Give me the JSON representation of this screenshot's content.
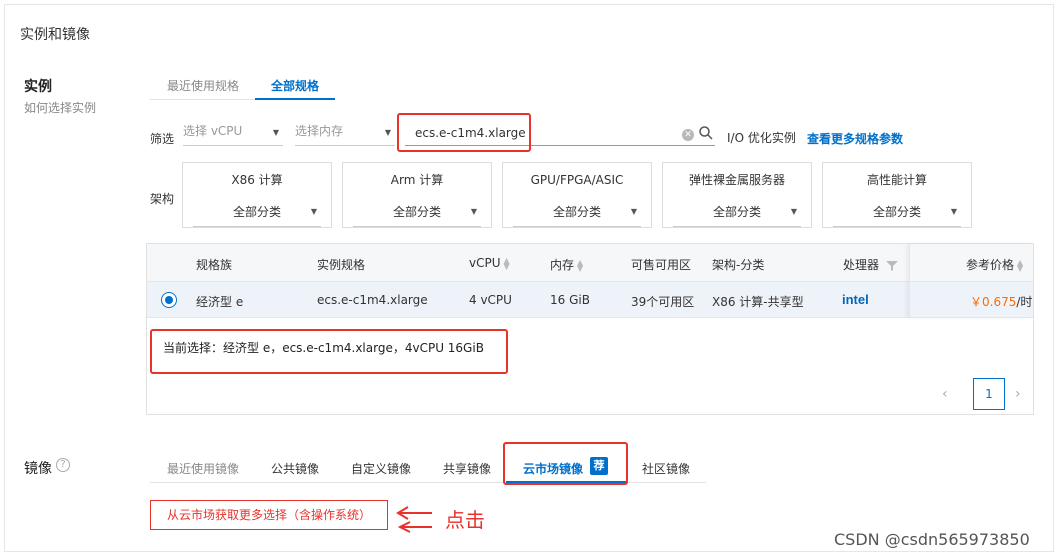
{
  "section_title": "实例和镜像",
  "instance": {
    "label": "实例",
    "help_text": "如何选择实例",
    "tabs": [
      {
        "label": "最近使用规格",
        "active": false
      },
      {
        "label": "全部规格",
        "active": true
      }
    ],
    "filter": {
      "label": "筛选",
      "vcpu_placeholder": "选择 vCPU",
      "memory_placeholder": "选择内存",
      "search_value": "ecs.e-c1m4.xlarge",
      "io_label": "I/O 优化实例",
      "more_link": "查看更多规格参数"
    },
    "arch": {
      "label": "架构",
      "cards": [
        {
          "title": "X86 计算",
          "select": "全部分类"
        },
        {
          "title": "Arm 计算",
          "select": "全部分类"
        },
        {
          "title": "GPU/FPGA/ASIC",
          "select": "全部分类"
        },
        {
          "title": "弹性裸金属服务器",
          "select": "全部分类"
        },
        {
          "title": "高性能计算",
          "select": "全部分类"
        }
      ]
    },
    "table": {
      "columns": [
        "规格族",
        "实例规格",
        "vCPU",
        "内存",
        "可售可用区",
        "架构-分类",
        "处理器",
        "参考价格"
      ],
      "row": {
        "family": "经济型 e",
        "spec": "ecs.e-c1m4.xlarge",
        "vcpu": "4 vCPU",
        "memory": "16 GiB",
        "zones": "39个可用区",
        "arch_class": "X86 计算-共享型",
        "processor": "intel",
        "price": "￥0.675",
        "price_unit": "/时"
      },
      "current_selection": "当前选择：经济型 e，ecs.e-c1m4.xlarge，4vCPU 16GiB",
      "page": "1"
    }
  },
  "image": {
    "label": "镜像",
    "tabs": [
      {
        "label": "最近使用镜像",
        "active": false
      },
      {
        "label": "公共镜像",
        "active": false
      },
      {
        "label": "自定义镜像",
        "active": false
      },
      {
        "label": "共享镜像",
        "active": false
      },
      {
        "label": "云市场镜像",
        "active": true,
        "badge": "荐"
      },
      {
        "label": "社区镜像",
        "active": false
      }
    ],
    "market_button": "从云市场获取更多选择（含操作系统）"
  },
  "annotation": "点击",
  "watermark": "CSDN @csdn565973850",
  "colors": {
    "accent": "#0070cc",
    "highlight_red": "#e8322c",
    "price_orange": "#ff6a00"
  }
}
